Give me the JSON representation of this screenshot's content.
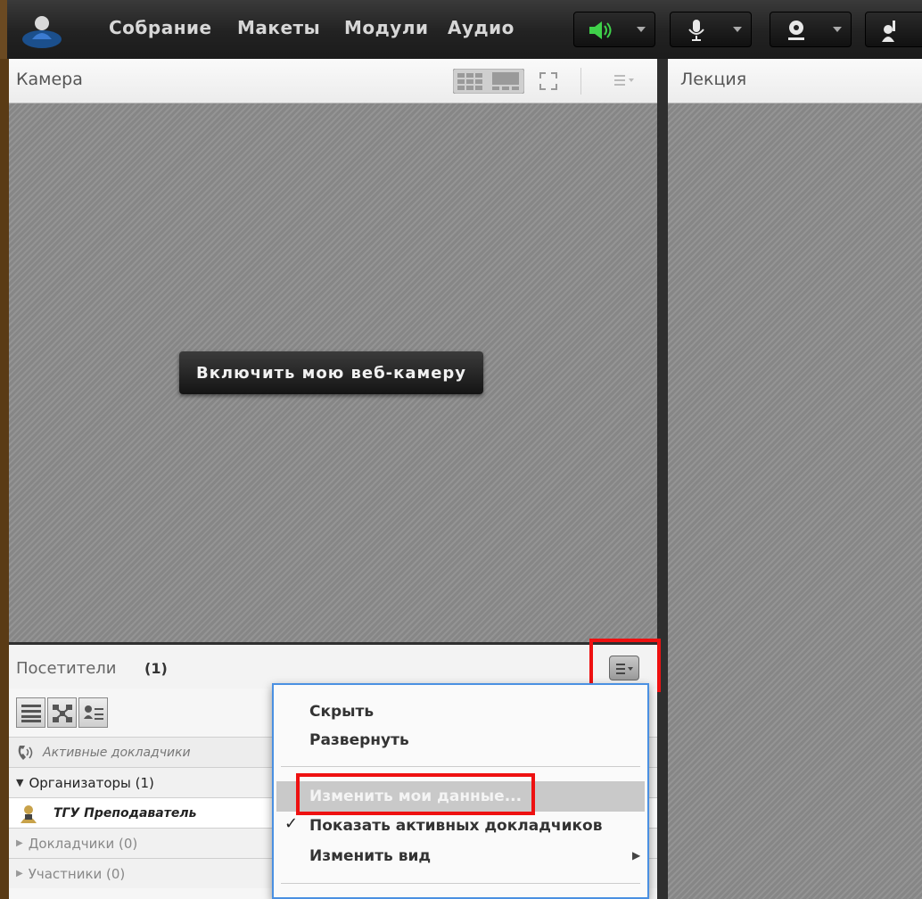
{
  "topbar": {
    "menu": [
      "Собрание",
      "Макеты",
      "Модули",
      "Аудио"
    ],
    "colors": {
      "speaker_active": "#3fd14a"
    }
  },
  "camera_pod": {
    "title": "Камера",
    "start_button": "Включить мою веб-камеру"
  },
  "lecture_pod": {
    "title": "Лекция"
  },
  "attendees_pod": {
    "title": "Посетители",
    "count": "(1)",
    "active_speakers": "Активные докладчики",
    "groups": [
      {
        "label": "Организаторы (1)",
        "expanded": true
      },
      {
        "label": "ТГУ Преподаватель",
        "is_user": true
      },
      {
        "label": "Докладчики (0)",
        "expanded": false
      },
      {
        "label": "Участники (0)",
        "expanded": false
      }
    ]
  },
  "dropdown_menu": {
    "items": [
      {
        "label": "Скрыть"
      },
      {
        "label": "Развернуть"
      },
      {
        "label": "Изменить мои данные..."
      },
      {
        "label": "Показать активных докладчиков",
        "checked": true
      },
      {
        "label": "Изменить вид",
        "submenu": true
      }
    ]
  },
  "annotation_color": "#ee1111"
}
